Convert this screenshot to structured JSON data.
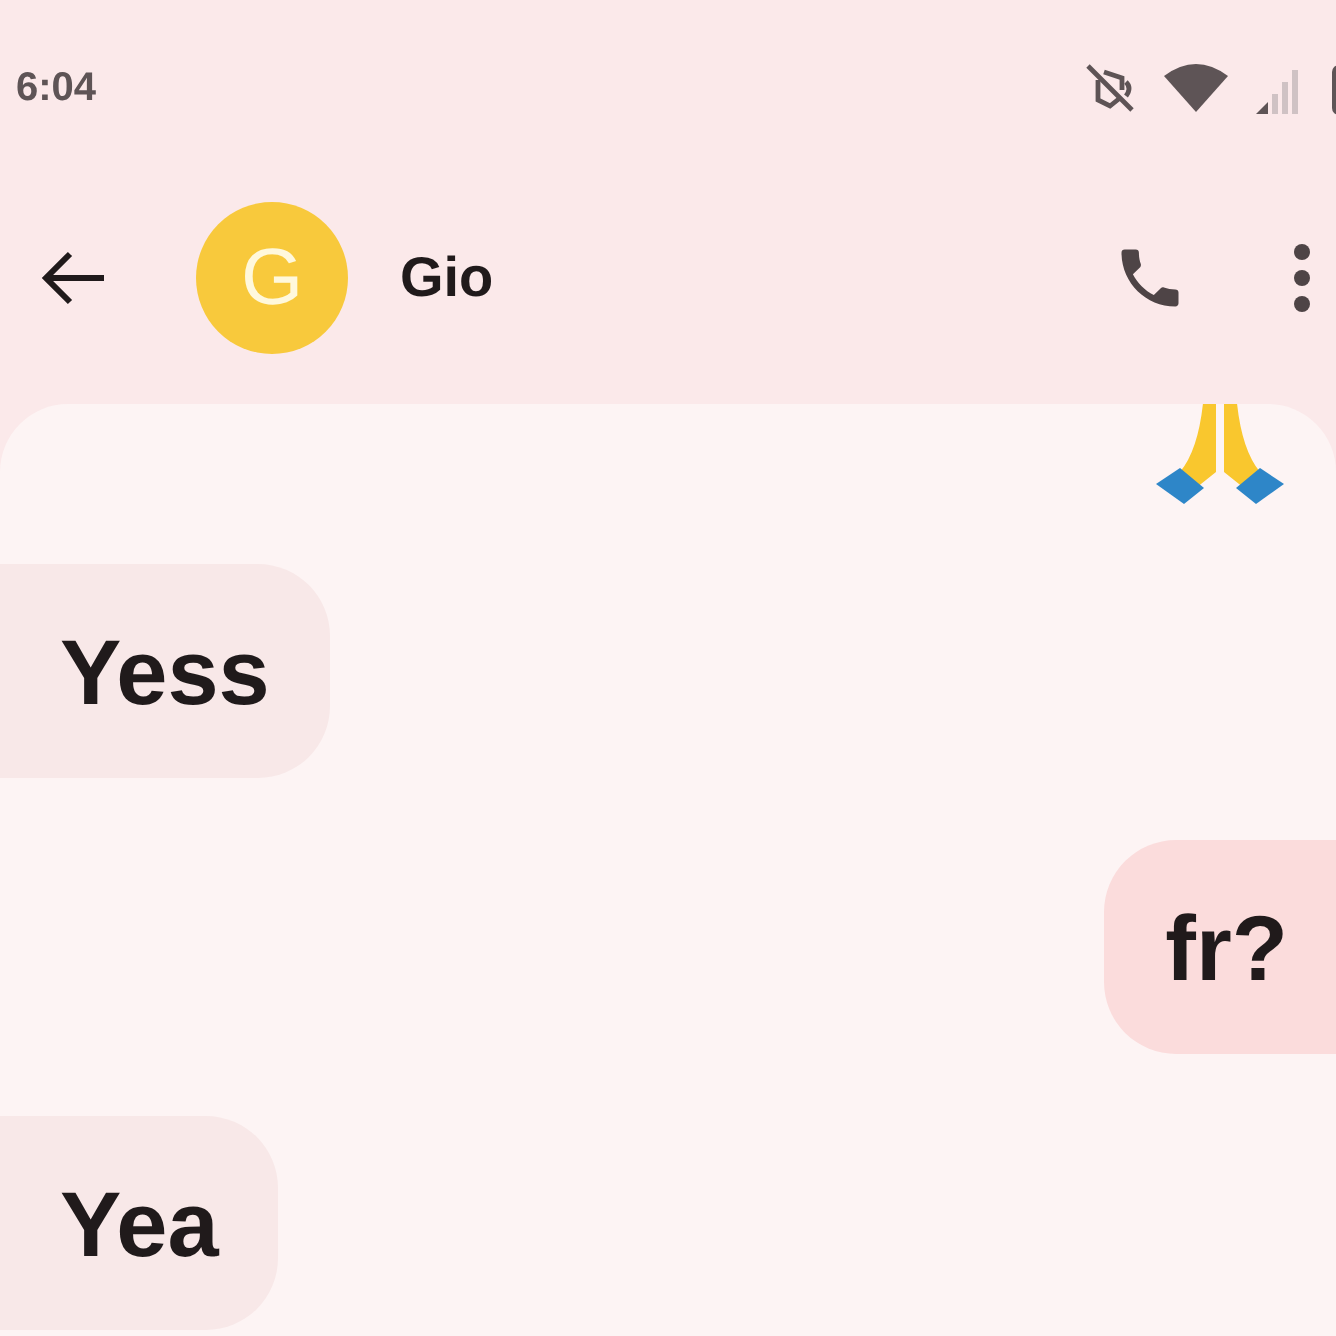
{
  "status_bar": {
    "time": "6:04"
  },
  "header": {
    "avatar_letter": "G",
    "name": "Gio"
  },
  "messages": [
    {
      "kind": "emoji"
    },
    {
      "kind": "received",
      "text": "Yess"
    },
    {
      "kind": "sent",
      "text": "fr?"
    },
    {
      "kind": "received",
      "text": "Yea"
    }
  ]
}
